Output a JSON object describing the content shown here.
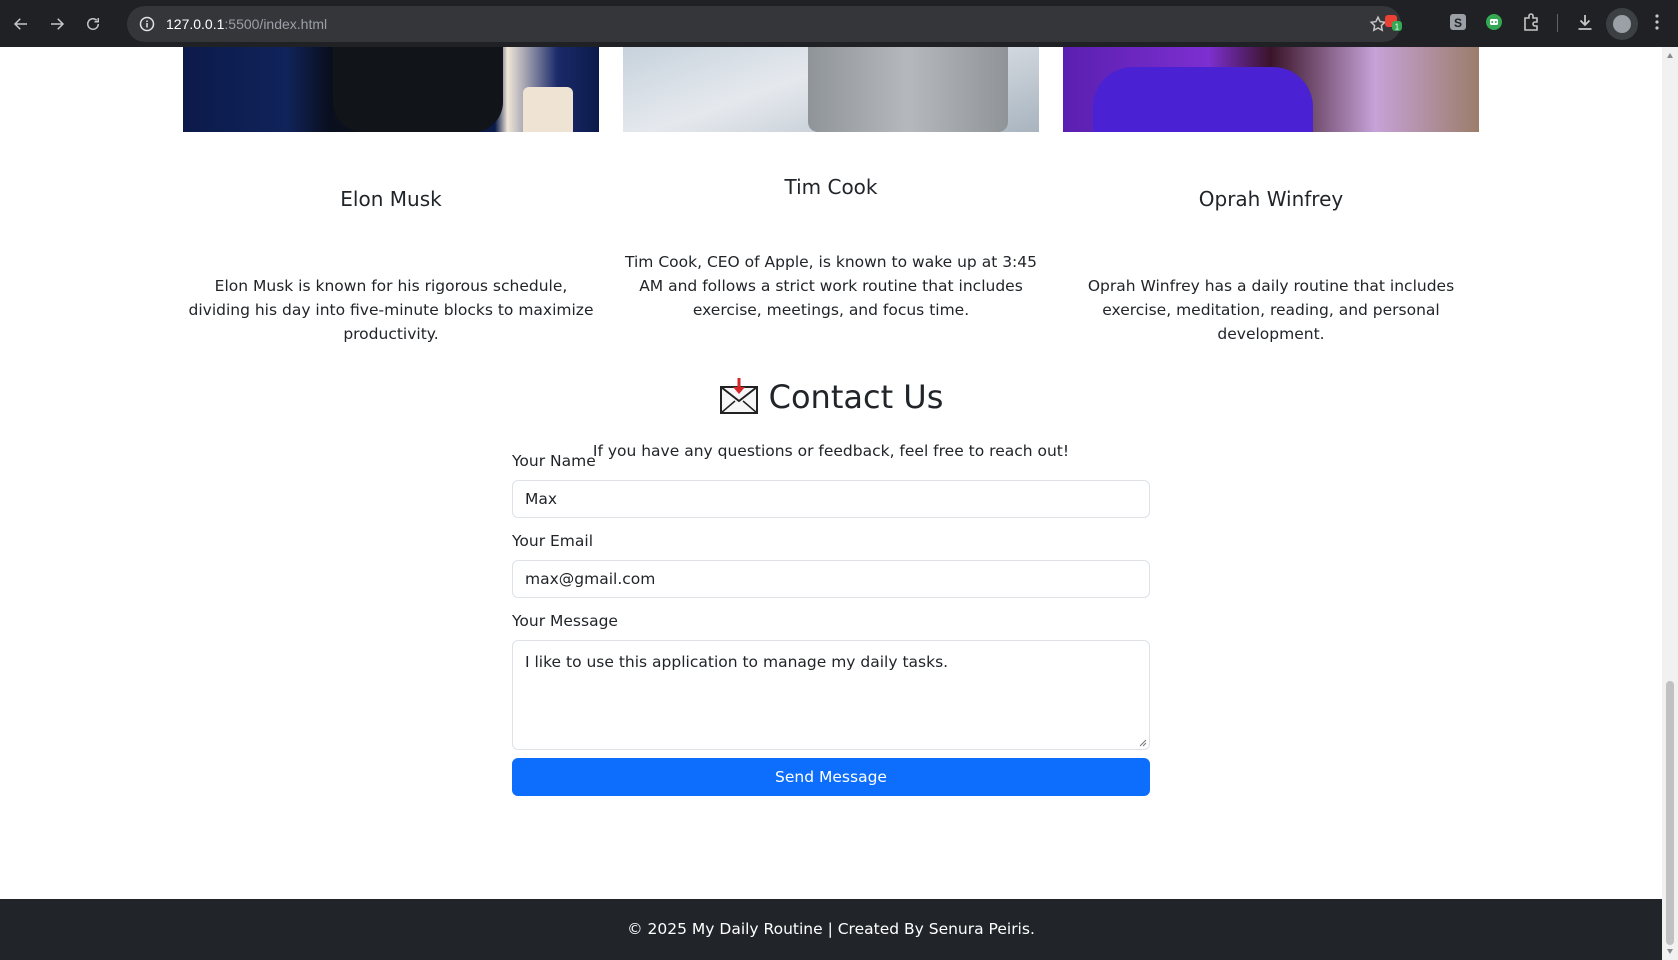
{
  "browser": {
    "url_host": "127.0.0.1",
    "url_rest": ":5500/index.html",
    "extensions": [
      "extension-badge-icon",
      "extension-s-icon",
      "extension-robot-icon",
      "puzzle-icon"
    ],
    "extension_badge_count": "1"
  },
  "cards": [
    {
      "name": "Elon Musk",
      "description": "Elon Musk is known for his rigorous schedule, dividing his day into five-minute blocks to maximize productivity."
    },
    {
      "name": "Tim Cook",
      "description": "Tim Cook, CEO of Apple, is known to wake up at 3:45 AM and follows a strict work routine that includes exercise, meetings, and focus time."
    },
    {
      "name": "Oprah Winfrey",
      "description": "Oprah Winfrey has a daily routine that includes exercise, meditation, reading, and personal development."
    }
  ],
  "contact": {
    "title": "Contact Us",
    "subtitle": "If you have any questions or feedback, feel free to reach out!",
    "name_label": "Your Name",
    "name_value": "Max",
    "email_label": "Your Email",
    "email_value": "max@gmail.com",
    "message_label": "Your Message",
    "message_value": "I like to use this application to manage my daily tasks.",
    "submit_label": "Send Message"
  },
  "footer": {
    "text": "© 2025 My Daily Routine | Created By Senura Peiris."
  },
  "colors": {
    "primary_button": "#0d6efd",
    "footer_bg": "#212529",
    "chrome_bg": "#202124"
  }
}
